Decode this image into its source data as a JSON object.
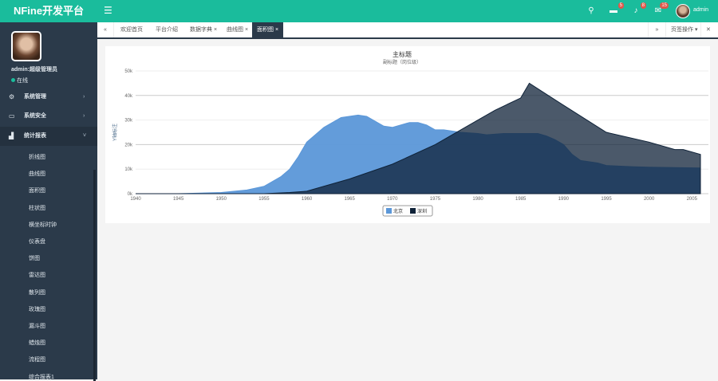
{
  "header": {
    "logo": "NFine开发平台",
    "menu_icon": "☰",
    "badges": {
      "messages": "5",
      "alerts": "8",
      "mail": "15"
    },
    "user": "admin"
  },
  "sidebar": {
    "user": "admin:超级管理员",
    "status": "在线",
    "menus": [
      {
        "label": "系统管理",
        "icon": "cogs-icon"
      },
      {
        "label": "系统安全",
        "icon": "desktop-icon"
      },
      {
        "label": "统计报表",
        "icon": "bar-chart-icon"
      }
    ],
    "sub_items": [
      "折线图",
      "曲线图",
      "面积图",
      "柱状图",
      "横坐标时钟",
      "仪表盘",
      "饼图",
      "雷达图",
      "散列图",
      "玫瑰图",
      "漏斗图",
      "蜡烛图",
      "流程图",
      "综合报表1"
    ]
  },
  "tabs": [
    {
      "label": "欢迎首页",
      "closable": false
    },
    {
      "label": "平台介绍",
      "closable": false
    },
    {
      "label": "数据字典",
      "closable": true
    },
    {
      "label": "曲线图",
      "closable": true
    },
    {
      "label": "面积图",
      "closable": true,
      "active": true
    }
  ],
  "tab_ops": "页签操作",
  "chart_data": {
    "type": "area",
    "title": "主标题",
    "subtitle": "副标题（岗位级）",
    "ylabel": "Y轴标注",
    "xlabel": "",
    "ylim": [
      0,
      50000
    ],
    "yticks": [
      "0k",
      "10k",
      "20k",
      "30k",
      "40k",
      "50k"
    ],
    "xlim": [
      1940,
      2006
    ],
    "xticks": [
      "1940",
      "1945",
      "1950",
      "1955",
      "1960",
      "1965",
      "1970",
      "1975",
      "1980",
      "1985",
      "1990",
      "1995",
      "2000",
      "2005"
    ],
    "legend": "bottom-center",
    "series": [
      {
        "name": "北京",
        "color": "#5b97d8",
        "points": [
          [
            1945,
            0
          ],
          [
            1950,
            500
          ],
          [
            1953,
            1500
          ],
          [
            1955,
            3000
          ],
          [
            1957,
            7000
          ],
          [
            1958,
            10000
          ],
          [
            1959,
            15000
          ],
          [
            1960,
            21000
          ],
          [
            1962,
            27000
          ],
          [
            1964,
            31000
          ],
          [
            1966,
            32000
          ],
          [
            1967,
            31500
          ],
          [
            1969,
            27500
          ],
          [
            1970,
            27000
          ],
          [
            1972,
            29000
          ],
          [
            1973,
            29000
          ],
          [
            1974,
            28000
          ],
          [
            1975,
            26000
          ],
          [
            1976,
            26000
          ],
          [
            1978,
            25000
          ],
          [
            1980,
            24500
          ],
          [
            1981,
            24000
          ],
          [
            1983,
            24500
          ],
          [
            1985,
            24500
          ],
          [
            1987,
            24500
          ],
          [
            1988,
            23500
          ],
          [
            1989,
            22000
          ],
          [
            1990,
            20000
          ],
          [
            1991,
            16000
          ],
          [
            1992,
            13500
          ],
          [
            1994,
            12500
          ],
          [
            1995,
            11500
          ],
          [
            1998,
            11000
          ],
          [
            2000,
            10800
          ],
          [
            2006,
            10500
          ]
        ]
      },
      {
        "name": "深圳",
        "color": "#0f2238",
        "points": [
          [
            1940,
            0
          ],
          [
            1955,
            0
          ],
          [
            1958,
            500
          ],
          [
            1960,
            1000
          ],
          [
            1965,
            6000
          ],
          [
            1970,
            12000
          ],
          [
            1975,
            20000
          ],
          [
            1978,
            26000
          ],
          [
            1980,
            30000
          ],
          [
            1982,
            34000
          ],
          [
            1985,
            39000
          ],
          [
            1986,
            45000
          ],
          [
            1990,
            36000
          ],
          [
            1995,
            25000
          ],
          [
            2000,
            21000
          ],
          [
            2003,
            18000
          ],
          [
            2004,
            18000
          ],
          [
            2006,
            16000
          ]
        ]
      }
    ]
  }
}
